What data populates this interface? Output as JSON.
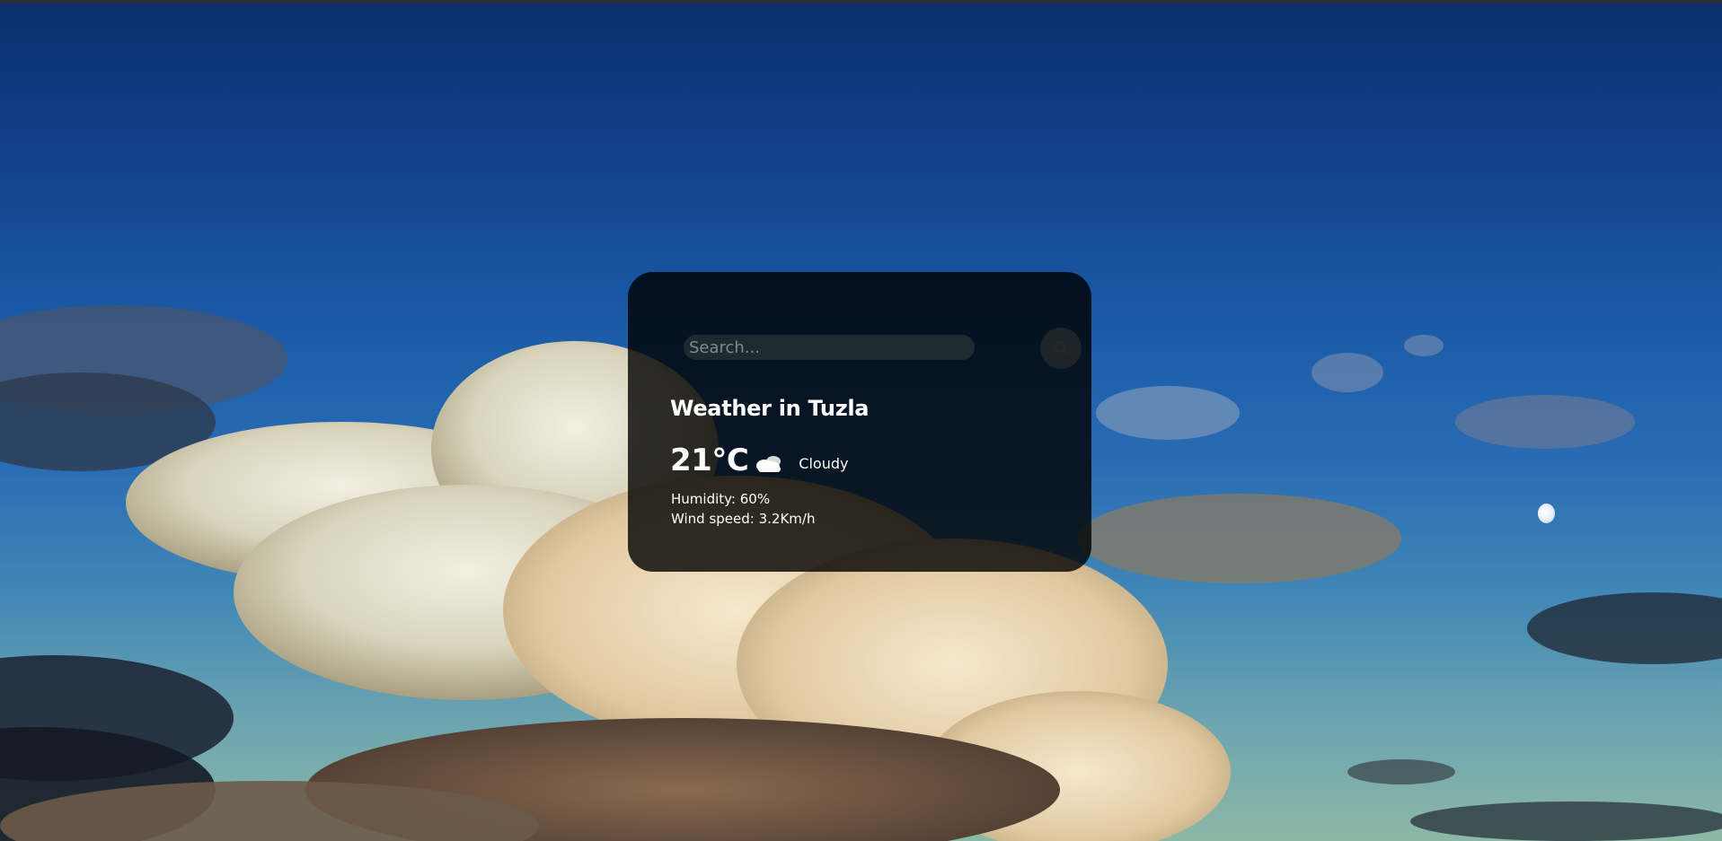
{
  "search": {
    "placeholder": "Search...",
    "value": ""
  },
  "weather": {
    "title": "Weather in Tuzla",
    "temperature": "21°C",
    "description": "Cloudy",
    "humidity": "Humidity: 60%",
    "wind": "Wind speed: 3.2Km/h",
    "icon": "cloud-icon"
  },
  "icons": {
    "search_button": "search-icon"
  },
  "colors": {
    "card_background": "rgba(0,0,0,0.80)",
    "text": "#ffffff",
    "input_background": "#1f2a30"
  }
}
